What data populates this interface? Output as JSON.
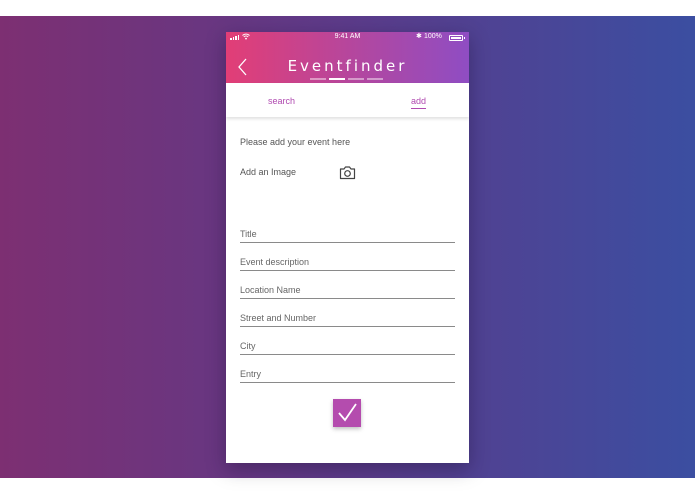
{
  "status_bar": {
    "time": "9:41 AM",
    "bluetooth": "✱",
    "battery_percent": "100%",
    "icons": [
      "signal-icon",
      "wifi-icon",
      "bluetooth-icon",
      "battery-icon"
    ]
  },
  "header": {
    "title": "Eventfinder",
    "back_icon": "chevron-left-icon",
    "page_indicator_count": 4,
    "page_indicator_active": 1
  },
  "tabs": [
    {
      "label": "search",
      "active": false
    },
    {
      "label": "add",
      "active": true
    }
  ],
  "form": {
    "intro": "Please add your event here",
    "image_label": "Add an Image",
    "image_icon": "camera-icon",
    "fields": {
      "title": "Title",
      "description": "Event description",
      "location": "Location Name",
      "street": "Street and Number",
      "city": "City",
      "entry": "Entry"
    },
    "submit_icon": "checkmark-icon"
  },
  "colors": {
    "accent": "#b44cae",
    "header_start": "#e23e76",
    "header_end": "#8f4dc3",
    "bg_left": "#7d2f72",
    "bg_right": "#3b4ea1"
  }
}
